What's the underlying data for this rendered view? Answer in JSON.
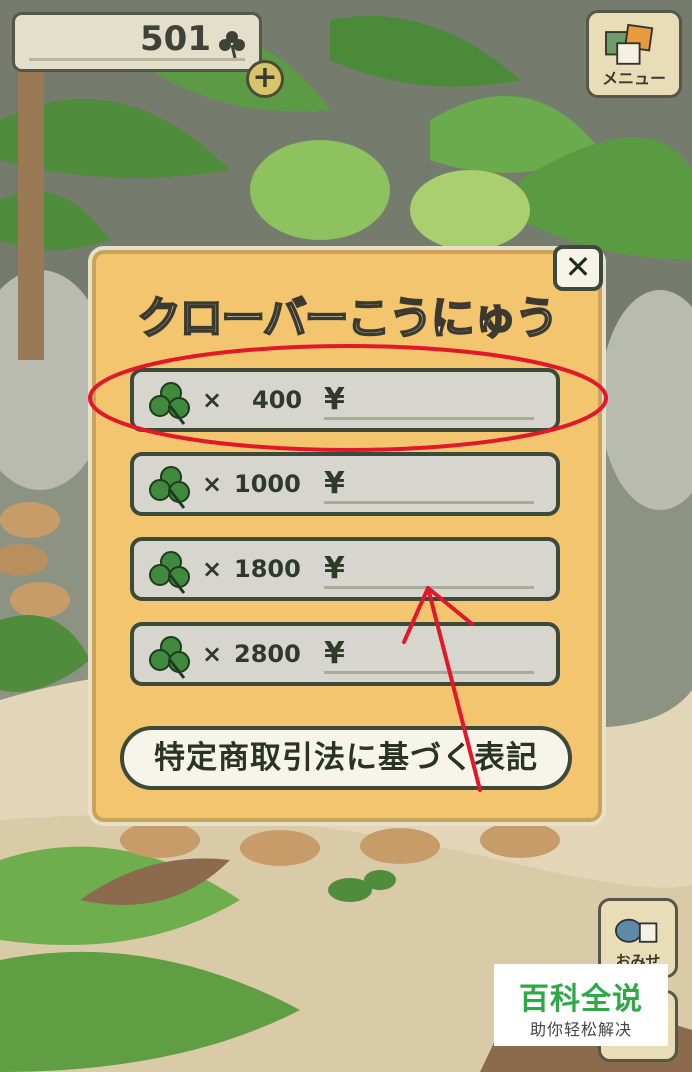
{
  "header": {
    "clover_count": "501",
    "add_label": "+",
    "menu_label": "メニュー"
  },
  "side_buttons": [
    {
      "label": "おみせ"
    }
  ],
  "dialog": {
    "title": "クローバーこうにゅう",
    "close_label": "✕",
    "options": [
      {
        "times": "×",
        "quantity": "400",
        "price": "¥"
      },
      {
        "times": "×",
        "quantity": "1000",
        "price": "¥"
      },
      {
        "times": "×",
        "quantity": "1800",
        "price": "¥"
      },
      {
        "times": "×",
        "quantity": "2800",
        "price": "¥"
      }
    ],
    "legal_button": "特定商取引法に基づく表記"
  },
  "watermark": {
    "title": "百科全说",
    "subtitle": "助你轻松解决"
  },
  "colors": {
    "dialog_bg": "#f2c56e",
    "option_bg": "#d6d6cf",
    "annotation_red": "#e0182a",
    "watermark_green": "#2fa848"
  }
}
